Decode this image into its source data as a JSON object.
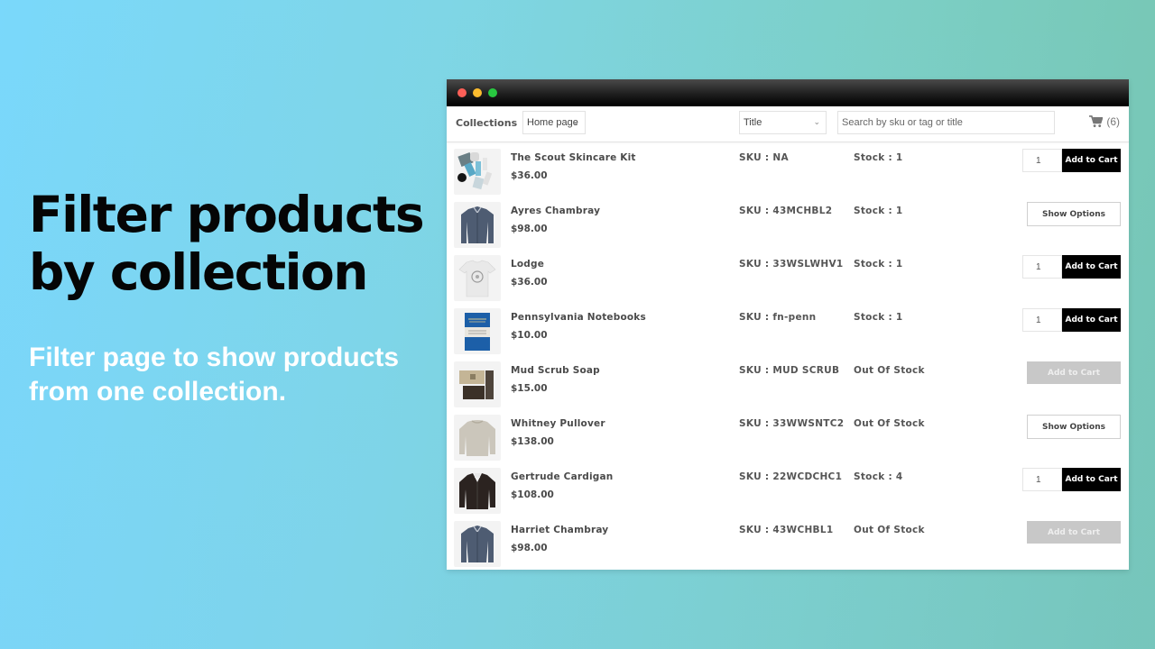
{
  "hero": {
    "title": "Filter products by collection",
    "subtitle": "Filter page to show products from one collection."
  },
  "window": {
    "controls": [
      "close",
      "minimize",
      "maximize"
    ]
  },
  "toolbar": {
    "collections_label": "Collections",
    "collection_select": "Home page",
    "field_select": "Title",
    "search_placeholder": "Search by sku or tag or title",
    "cart_count": "(6)"
  },
  "products": [
    {
      "name": "The Scout Skincare Kit",
      "price": "$36.00",
      "sku": "SKU : NA",
      "stock": "Stock : 1",
      "action": "add",
      "qty": "1",
      "button": "Add to Cart",
      "image": "skincare-kit"
    },
    {
      "name": "Ayres Chambray",
      "price": "$98.00",
      "sku": "SKU : 43MCHBL2",
      "stock": "Stock : 1",
      "action": "options",
      "button": "Show Options",
      "image": "chambray-shirt"
    },
    {
      "name": "Lodge",
      "price": "$36.00",
      "sku": "SKU : 33WSLWHV1",
      "stock": "Stock : 1",
      "action": "add",
      "qty": "1",
      "button": "Add to Cart",
      "image": "white-tshirt"
    },
    {
      "name": "Pennsylvania Notebooks",
      "price": "$10.00",
      "sku": "SKU : fn-penn",
      "stock": "Stock : 1",
      "action": "add",
      "qty": "1",
      "button": "Add to Cart",
      "image": "blue-notebook"
    },
    {
      "name": "Mud Scrub Soap",
      "price": "$15.00",
      "sku": "SKU : MUD SCRUB",
      "stock": "Out Of Stock",
      "action": "disabled",
      "button": "Add to Cart",
      "image": "soap"
    },
    {
      "name": "Whitney Pullover",
      "price": "$138.00",
      "sku": "SKU : 33WWSNTC2",
      "stock": "Out Of Stock",
      "action": "options",
      "button": "Show Options",
      "image": "grey-pullover"
    },
    {
      "name": "Gertrude Cardigan",
      "price": "$108.00",
      "sku": "SKU : 22WCDCHC1",
      "stock": "Stock : 4",
      "action": "add",
      "qty": "1",
      "button": "Add to Cart",
      "image": "black-cardigan"
    },
    {
      "name": "Harriet Chambray",
      "price": "$98.00",
      "sku": "SKU : 43WCHBL1",
      "stock": "Out Of Stock",
      "action": "disabled",
      "button": "Add to Cart",
      "image": "chambray-shirt"
    }
  ],
  "colors": {
    "add_button": "#000000",
    "disabled_button": "#c8c8c8",
    "hero_title": "#050505",
    "hero_subtitle": "#ffffff"
  }
}
